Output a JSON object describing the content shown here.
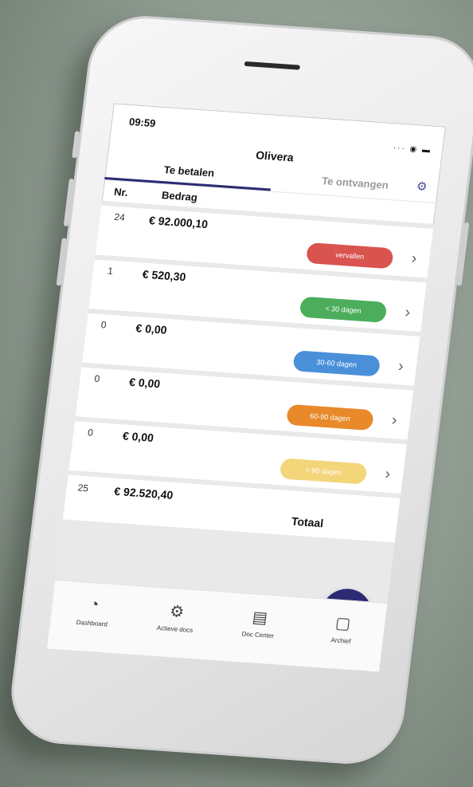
{
  "status": {
    "time": "09:59",
    "icons": "··· ◉ ▬"
  },
  "app": {
    "title": "Olivera"
  },
  "tabs": [
    {
      "label": "Te betalen",
      "active": true
    },
    {
      "label": "Te ontvangen",
      "active": false
    }
  ],
  "columns": {
    "nr": "Nr.",
    "amount": "Bedrag"
  },
  "rows": [
    {
      "nr": "24",
      "amount": "€ 92.000,10",
      "badge": "vervallen",
      "color": "#d9534f"
    },
    {
      "nr": "1",
      "amount": "€ 520,30",
      "badge": "< 30 dagen",
      "color": "#4cae5c"
    },
    {
      "nr": "0",
      "amount": "€ 0,00",
      "badge": "30-60 dagen",
      "color": "#4a90d9"
    },
    {
      "nr": "0",
      "amount": "€ 0,00",
      "badge": "60-90 dagen",
      "color": "#e8892a"
    },
    {
      "nr": "0",
      "amount": "€ 0,00",
      "badge": "> 90 dagen",
      "color": "#f3d57a"
    }
  ],
  "total": {
    "nr": "25",
    "amount": "€ 92.520,40",
    "label": "Totaal"
  },
  "fab": {
    "icon": "plus-icon",
    "symbol": "+"
  },
  "nav": [
    {
      "label": "Dashboard",
      "icon": "gauge-icon",
      "glyph": "◔"
    },
    {
      "label": "Actieve docs",
      "icon": "document-gear-icon",
      "glyph": "⚙"
    },
    {
      "label": "Doc Center",
      "icon": "folder-gear-icon",
      "glyph": "▤"
    },
    {
      "label": "Archief",
      "icon": "open-folder-icon",
      "glyph": "▢"
    }
  ],
  "colors": {
    "primary": "#2b2a73",
    "background": "#8d998f"
  }
}
